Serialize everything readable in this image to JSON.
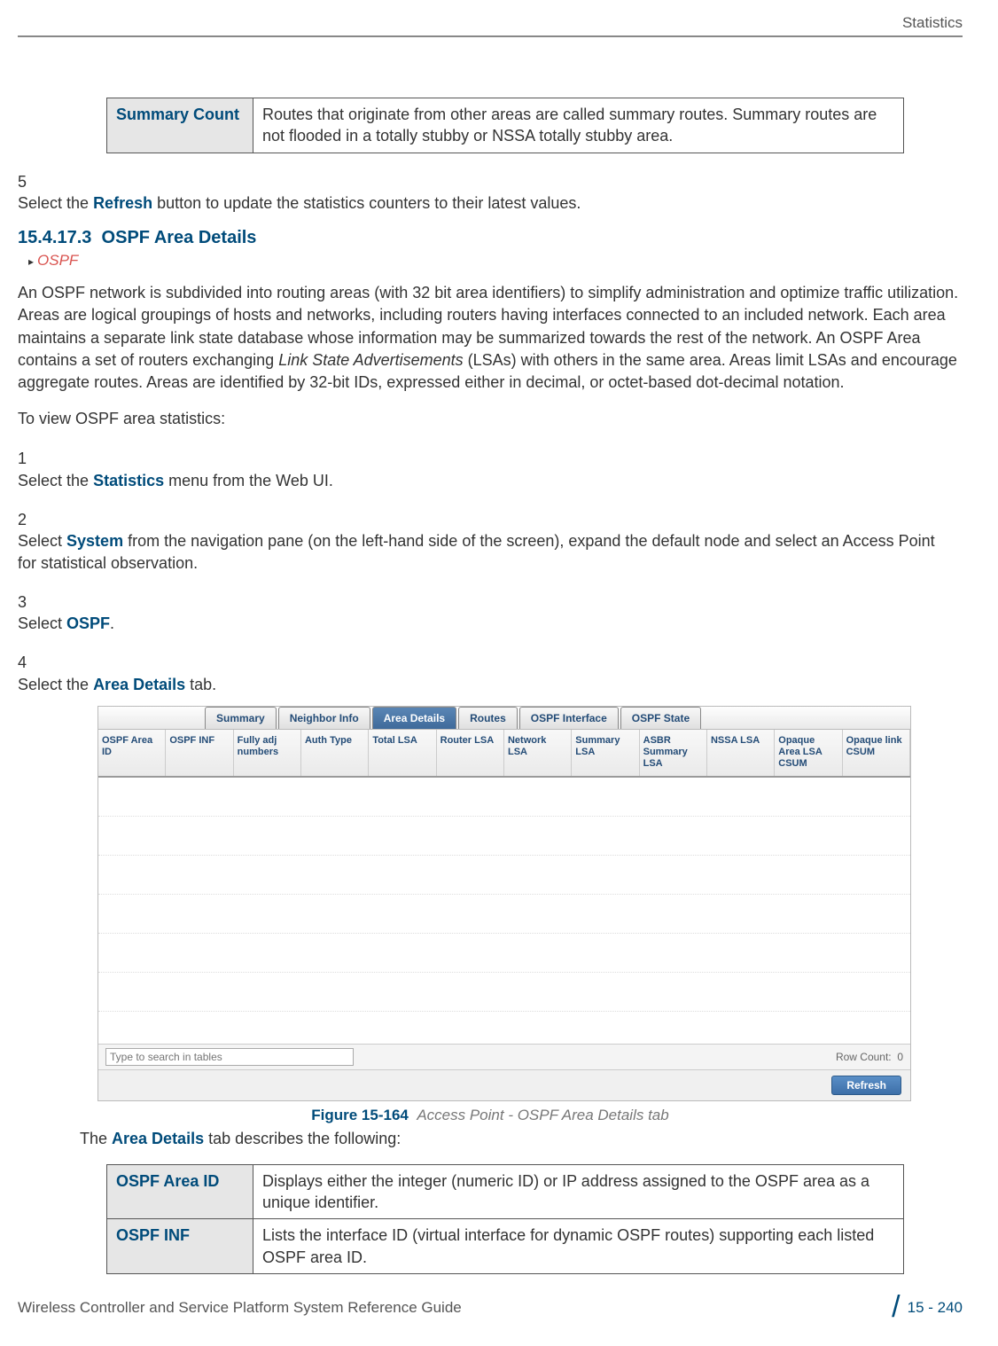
{
  "header": {
    "section": "Statistics"
  },
  "table1": {
    "term": "Summary Count",
    "desc": "Routes that originate from other areas are called summary routes. Summary routes are not flooded in a totally stubby or NSSA totally stubby area."
  },
  "step5": {
    "num": "5",
    "pre": "Select the ",
    "bold": "Refresh",
    "post": " button to update the statistics counters to their latest values."
  },
  "section": {
    "num": "15.4.17.3",
    "title": "OSPF Area Details",
    "breadcrumb": "OSPF"
  },
  "para1_a": "An OSPF network is subdivided into routing areas (with 32 bit area identifiers) to simplify administration and optimize traffic utilization. Areas are logical groupings of hosts and networks, including routers having interfaces connected to an included network. Each area maintains a separate link state database whose information may be summarized towards the rest of the network. An OSPF Area contains a set of routers exchanging ",
  "para1_em": "Link State Advertisements",
  "para1_b": " (LSAs) with others in the same area. Areas limit LSAs and encourage aggregate routes. Areas are identified by 32-bit IDs, expressed either in decimal, or octet-based dot-decimal notation.",
  "para2": "To view OSPF area statistics:",
  "steps": [
    {
      "num": "1",
      "pre": "Select the ",
      "bold": "Statistics",
      "post": " menu from the Web UI."
    },
    {
      "num": "2",
      "pre": "Select ",
      "bold": "System",
      "post": " from the navigation pane (on the left-hand side of the screen), expand the default node and select an Access Point for statistical observation."
    },
    {
      "num": "3",
      "pre": "Select ",
      "bold": "OSPF",
      "post": "."
    },
    {
      "num": "4",
      "pre": "Select the ",
      "bold": "Area Details",
      "post": " tab."
    }
  ],
  "ui": {
    "tabs": [
      "Summary",
      "Neighbor Info",
      "Area Details",
      "Routes",
      "OSPF Interface",
      "OSPF State"
    ],
    "active_tab_index": 2,
    "cols": [
      "OSPF Area ID",
      "OSPF INF",
      "Fully adj numbers",
      "Auth Type",
      "Total LSA",
      "Router LSA",
      "Network LSA",
      "Summary LSA",
      "ASBR Summary LSA",
      "NSSA LSA",
      "Opaque Area LSA CSUM",
      "Opaque link CSUM"
    ],
    "search_placeholder": "Type to search in tables",
    "row_count_label": "Row Count:",
    "row_count": "0",
    "refresh": "Refresh"
  },
  "figure": {
    "label": "Figure 15-164",
    "caption": "Access Point - OSPF Area Details tab"
  },
  "para3_a": "The ",
  "para3_bold": "Area Details",
  "para3_b": " tab describes the following:",
  "table2": [
    {
      "term": "OSPF Area ID",
      "desc": "Displays either the integer (numeric ID) or IP address assigned to the OSPF area as a unique identifier."
    },
    {
      "term": "OSPF INF",
      "desc": "Lists the interface ID (virtual interface for dynamic OSPF routes) supporting each listed OSPF area ID."
    }
  ],
  "footer": {
    "left": "Wireless Controller and Service Platform System Reference Guide",
    "right": "15 - 240"
  }
}
